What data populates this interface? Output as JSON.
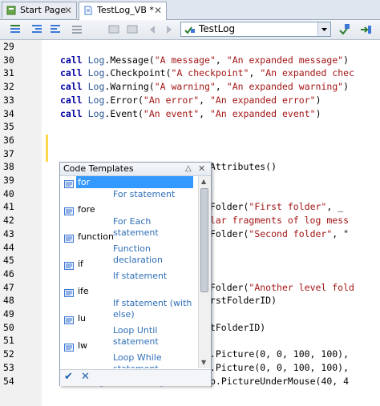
{
  "tabs": [
    {
      "label": "Start Page",
      "close": "✕"
    },
    {
      "label": "TestLog_VB *",
      "close": "✕"
    }
  ],
  "toolbar": {
    "routine_combo": "TestLog"
  },
  "lines": [
    {
      "num": "29",
      "code": []
    },
    {
      "num": "30",
      "code": [
        [
          "kw",
          "call "
        ],
        [
          "obj",
          "Log"
        ],
        [
          "",
          "."
        ],
        [
          "",
          "Message("
        ],
        [
          "str",
          "\"A message\""
        ],
        [
          "",
          ", "
        ],
        [
          "str",
          "\"An expanded message\""
        ],
        [
          "",
          ")"
        ]
      ]
    },
    {
      "num": "31",
      "code": [
        [
          "kw",
          "call "
        ],
        [
          "obj",
          "Log"
        ],
        [
          "",
          "."
        ],
        [
          "",
          "Checkpoint("
        ],
        [
          "str",
          "\"A checkpoint\""
        ],
        [
          "",
          ", "
        ],
        [
          "str",
          "\"An expanded chec"
        ]
      ]
    },
    {
      "num": "32",
      "code": [
        [
          "kw",
          "call "
        ],
        [
          "obj",
          "Log"
        ],
        [
          "",
          "."
        ],
        [
          "",
          "Warning("
        ],
        [
          "str",
          "\"A warning\""
        ],
        [
          "",
          ", "
        ],
        [
          "str",
          "\"An expanded warning\""
        ],
        [
          "",
          ")"
        ]
      ]
    },
    {
      "num": "33",
      "code": [
        [
          "kw",
          "call "
        ],
        [
          "obj",
          "Log"
        ],
        [
          "",
          "."
        ],
        [
          "",
          "Error("
        ],
        [
          "str",
          "\"An error\""
        ],
        [
          "",
          ", "
        ],
        [
          "str",
          "\"An expanded error\""
        ],
        [
          "",
          ")"
        ]
      ]
    },
    {
      "num": "34",
      "code": [
        [
          "kw",
          "call "
        ],
        [
          "obj",
          "Log"
        ],
        [
          "",
          "."
        ],
        [
          "",
          "Event("
        ],
        [
          "str",
          "\"An event\""
        ],
        [
          "",
          ", "
        ],
        [
          "str",
          "\"An expanded event\""
        ],
        [
          "",
          ")"
        ]
      ]
    },
    {
      "num": "35",
      "code": []
    },
    {
      "num": "36",
      "code": []
    },
    {
      "num": "37",
      "code": []
    },
    {
      "num": "38",
      "code": [
        [
          "",
          "                        NewAttributes()"
        ]
      ]
    },
    {
      "num": "39",
      "code": []
    },
    {
      "num": "40",
      "code": []
    },
    {
      "num": "41",
      "code": [
        [
          "",
          "                        ateFolder("
        ],
        [
          "str",
          "\"First folder\""
        ],
        [
          "",
          ", _"
        ]
      ]
    },
    {
      "num": "42",
      "code": [
        [
          "str",
          "                        imilar fragments of log mess"
        ]
      ]
    },
    {
      "num": "43",
      "code": [
        [
          "",
          "                        ateFolder("
        ],
        [
          "str",
          "\"Second folder\""
        ],
        [
          "",
          ", \""
        ]
      ]
    },
    {
      "num": "44",
      "code": []
    },
    {
      "num": "45",
      "code": []
    },
    {
      "num": "46",
      "code": []
    },
    {
      "num": "47",
      "code": [
        [
          "",
          "                        ateFolder("
        ],
        [
          "str",
          "\"Another level fold"
        ]
      ]
    },
    {
      "num": "48",
      "code": [
        [
          "",
          "                        nFirstFolderID)"
        ]
      ]
    },
    {
      "num": "49",
      "code": []
    },
    {
      "num": "50",
      "code": [
        [
          "",
          "                        irstFolderID)"
        ]
      ]
    },
    {
      "num": "51",
      "code": []
    },
    {
      "num": "52",
      "code": [
        [
          "",
          "                        top.Picture(0, 0, 100, 100),"
        ]
      ]
    },
    {
      "num": "53",
      "code": [
        [
          "",
          "                        top.Picture(0, 0, 100, 100),"
        ]
      ]
    },
    {
      "num": "54",
      "code": [
        [
          "kw",
          "call "
        ],
        [
          "obj",
          "Log"
        ],
        [
          "",
          "."
        ],
        [
          "",
          "Picture("
        ],
        [
          "obj",
          "Sys"
        ],
        [
          "",
          ".Desktop.PictureUnderMouse(40, 4"
        ]
      ]
    }
  ],
  "popup": {
    "title": "Code Templates",
    "collapse": "△",
    "close": "✕",
    "items": [
      {
        "name": "for",
        "desc": "For statement",
        "selected": true
      },
      {
        "name": "fore",
        "desc": "For Each statement",
        "selected": false
      },
      {
        "name": "function",
        "desc": "Function declaration",
        "selected": false
      },
      {
        "name": "if",
        "desc": "If statement",
        "selected": false
      },
      {
        "name": "ife",
        "desc": "If statement (with else)",
        "selected": false
      },
      {
        "name": "lu",
        "desc": "Loop Until statement",
        "selected": false
      },
      {
        "name": "lw",
        "desc": "Loop While statement",
        "selected": false
      }
    ],
    "ok_glyph": "✔",
    "cancel_glyph": "✕"
  },
  "colors": {
    "keyword": "#0000a0",
    "string": "#a31515",
    "object": "#2b5797",
    "selection": "#3399ff"
  }
}
